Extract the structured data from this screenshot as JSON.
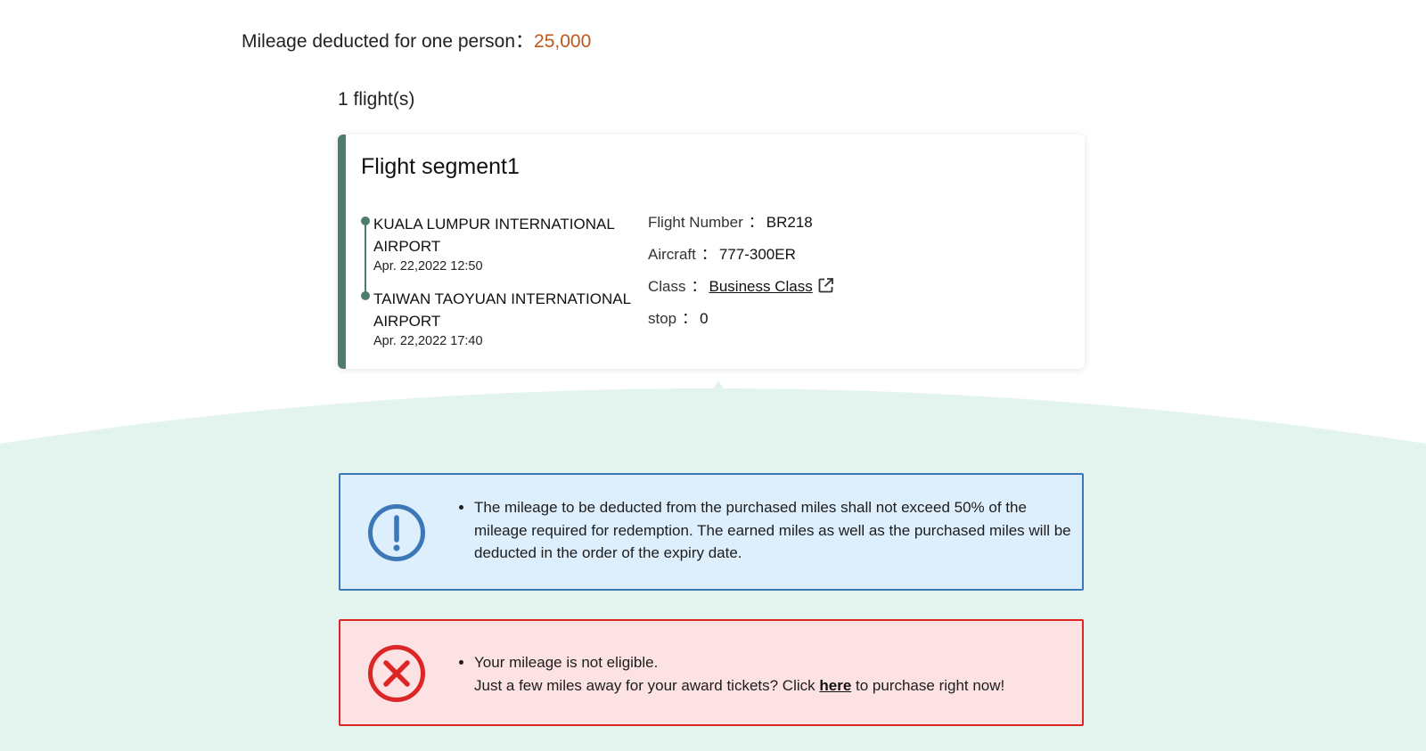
{
  "summary": {
    "mileage_label": "Mileage deducted for one person",
    "separator": "：",
    "mileage_value": "25,000",
    "flights_count": "1 flight(s)"
  },
  "segment": {
    "title": "Flight segment1",
    "departure": {
      "airport": "KUALA LUMPUR INTERNATIONAL AIRPORT",
      "datetime": "Apr. 22,2022 12:50"
    },
    "arrival": {
      "airport": "TAIWAN TAOYUAN INTERNATIONAL AIRPORT",
      "datetime": "Apr. 22,2022 17:40"
    },
    "details": [
      {
        "label": "Flight Number",
        "value": "BR218"
      },
      {
        "label": "Aircraft",
        "value": "777-300ER"
      },
      {
        "label": "Class",
        "value": "Business Class"
      },
      {
        "label": "stop",
        "value": "0"
      }
    ],
    "separator": "："
  },
  "info_notice": {
    "icon": "exclamation-circle-icon",
    "text": "The mileage to be deducted from the purchased miles shall not exceed 50% of the mileage required for redemption. The earned miles as well as the purchased miles will be deducted in the order of the expiry date."
  },
  "error_notice": {
    "icon": "x-circle-icon",
    "line1": "Your mileage is not eligible.",
    "line2_before": "Just a few miles away for your award tickets? Click ",
    "link_text": "here",
    "line2_after": " to purchase right now!"
  },
  "colors": {
    "accent_green": "#4e7e6b",
    "mileage_orange": "#c0561a",
    "info_blue": "#3c77b8",
    "info_bg": "#ddeefc",
    "error_red": "#dc2626",
    "error_bg": "#fde2e3",
    "background_mint": "#e3f3ed"
  }
}
